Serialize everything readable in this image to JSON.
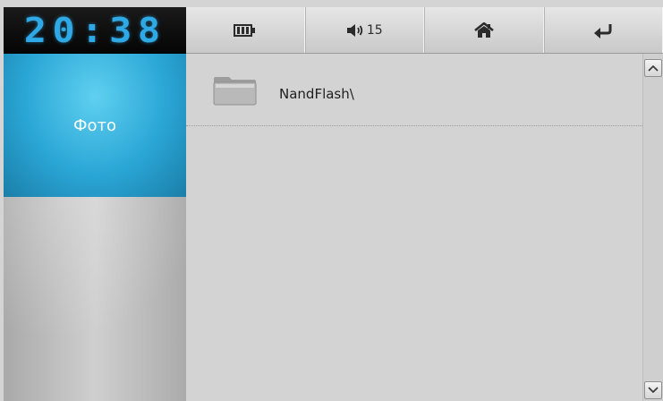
{
  "clock": {
    "time": "20:38"
  },
  "toolbar": {
    "battery_icon": "battery-icon",
    "volume_icon": "speaker-icon",
    "volume_level": "15",
    "home_icon": "home-icon",
    "back_icon": "back-arrow-icon"
  },
  "sidebar": {
    "items": [
      {
        "label": "Фото",
        "selected": true
      }
    ],
    "accent_color": "#2aa6d6"
  },
  "file_list": {
    "items": [
      {
        "name": "NandFlash\\",
        "type_icon": "folder-icon"
      }
    ]
  },
  "scrollbar": {
    "up_icon": "chevron-up-icon",
    "down_icon": "chevron-down-icon"
  }
}
